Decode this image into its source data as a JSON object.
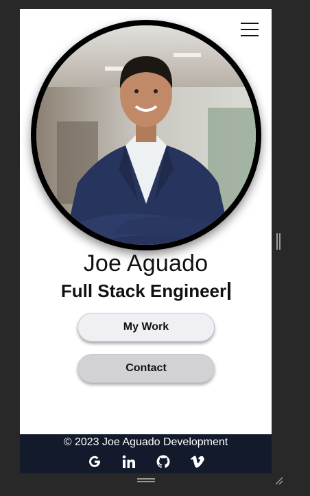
{
  "header": {
    "menu_icon": "hamburger-menu-icon"
  },
  "profile": {
    "photo": "profile-photo",
    "name": "Joe Aguado",
    "role": "Full Stack Engineer"
  },
  "buttons": {
    "work_label": "My Work",
    "contact_label": "Contact"
  },
  "footer": {
    "copyright": "© 2023 Joe Aguado Development",
    "social_icons": [
      "google-icon",
      "linkedin-icon",
      "github-icon",
      "vimeo-icon"
    ]
  },
  "colors": {
    "page_background": "#282828",
    "card_background": "#ffffff",
    "footer_background": "#131a2b",
    "work_button": "#efeff4",
    "contact_button": "#d2d1d6",
    "suit_blue": "#27345e"
  }
}
